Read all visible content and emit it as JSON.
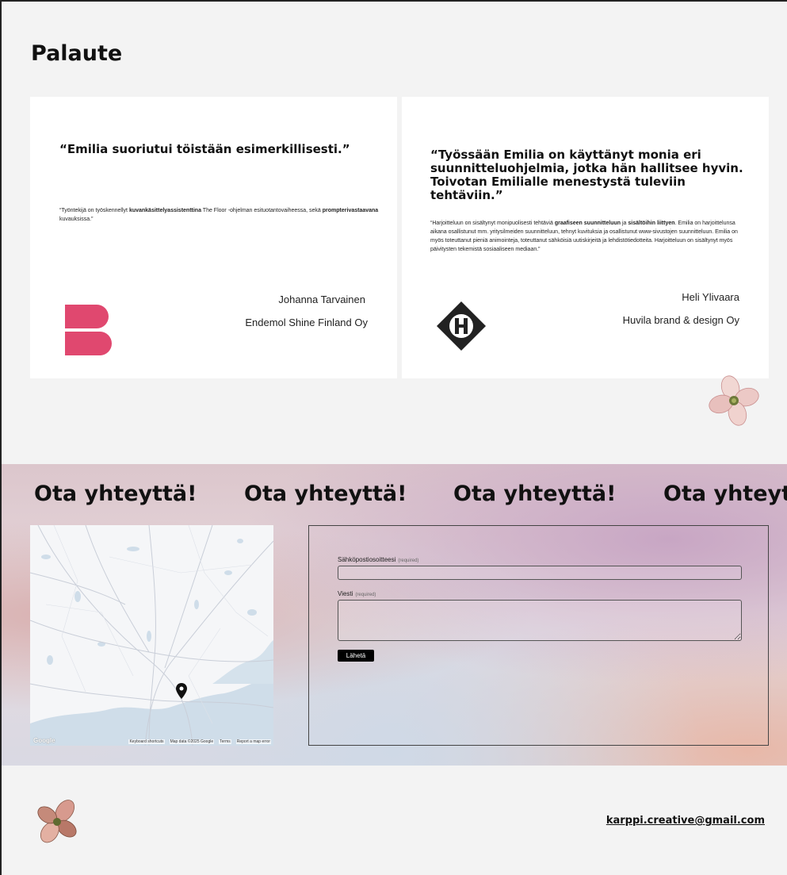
{
  "palaute": {
    "title": "Palaute",
    "cards": [
      {
        "quote": "“Emilia suoriutui töistään esimerkillisesti.”",
        "desc_parts": [
          "“Työntekijä on työskennellyt ",
          "kuvankäsittelyassistenttina",
          " The Floor -ohjelman esituotantovaiheessa, sekä ",
          "prompterivastaavana",
          " kuvauksissa.”"
        ],
        "name": "Johanna Tarvainen",
        "company": "Endemol Shine Finland Oy",
        "logo": "endemol-b-logo"
      },
      {
        "quote": "“Työssään Emilia on käyttänyt monia eri suunnitteluohjelmia, jotka hän hallitsee hyvin. Toivotan Emilialle menestystä tuleviin tehtäviin.”",
        "desc_parts": [
          "“Harjoitteluun on sisältynyt monipuolisesti tehtäviä ",
          "graafiseen suunnitteluun",
          " ja ",
          "sisältöihin liittyen",
          ". Emilia on harjoittelunsa aikana osallistunut mm. yritysilmeiden suunnitteluun, tehnyt kuvituksia ja osallistunut www-sivustojen suunnitteluun. Emilia on myös toteuttanut pieniä animointeja, toteuttanut sähköisiä uutiskirjeitä ja lehdistötiedotteita. Harjoitteluun on sisältynyt myös päivitysten tekemistä sosiaaliseen mediaan.”"
        ],
        "name": "Heli Ylivaara",
        "company": "Huvila brand & design Oy",
        "logo": "huvila-h-logo"
      }
    ]
  },
  "contact": {
    "marquee_text": "Ota yhteyttä!",
    "map": {
      "google_label": "Google",
      "keyboard_shortcuts": "Keyboard shortcuts",
      "map_data": "Map data ©2025 Google",
      "terms": "Terms",
      "report": "Report a map error"
    },
    "form": {
      "email_label": "Sähköpostiosoitteesi",
      "message_label": "Viesti",
      "required": "(required)",
      "submit_label": "Lähetä"
    }
  },
  "footer": {
    "email": "karppi.creative@gmail.com"
  },
  "colors": {
    "logo_b": "#e0486f",
    "logo_h": "#222222",
    "background": "#f3f3f3"
  }
}
